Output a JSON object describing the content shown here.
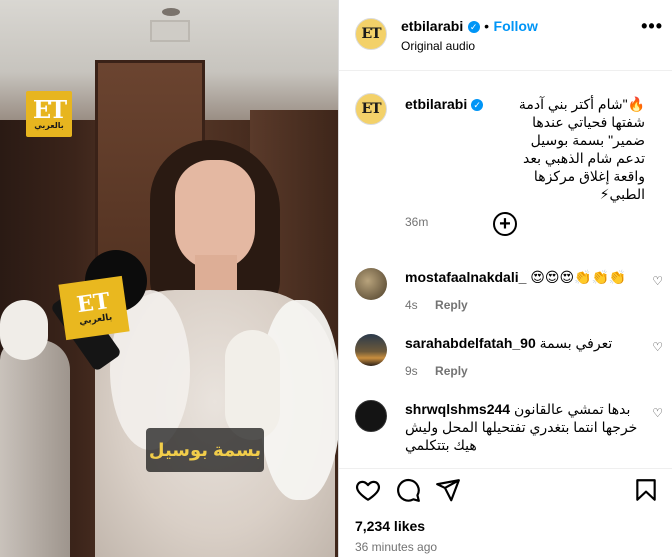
{
  "media": {
    "logo": {
      "big": "ET",
      "small": "بالعربي"
    },
    "mic_logo": {
      "big": "ET",
      "small": "بالعربي"
    },
    "caption_overlay": "بسمة بوسيل"
  },
  "header": {
    "username": "etbilarabi",
    "verified_icon": "verified-badge-icon",
    "dot": "•",
    "follow_label": "Follow",
    "subtitle": "Original audio",
    "avatar_text": "ET",
    "more_icon": "more-horizontal-icon"
  },
  "caption": {
    "username": "etbilarabi",
    "avatar_text": "ET",
    "text": "🔥\"شام أكتر بني آدمة شفتها فحياتي عندها ضمير\" بسمة بوسيل تدعم شام الذهبي بعد واقعة إغلاق مركزها الطبي⚡",
    "time": "36m"
  },
  "load_more_icon": "plus-circle-icon",
  "comments": [
    {
      "username": "mostafaalnakdali_",
      "text": "😍😍😍👏👏👏",
      "time": "4s",
      "reply_label": "Reply"
    },
    {
      "username": "sarahabdelfatah_90",
      "text": "تعرفي بسمة",
      "time": "9s",
      "reply_label": "Reply"
    },
    {
      "username": "shrwqlshms244",
      "text": "بدها تمشي عالقانون خرجها انتما بتغدري تفتحيلها المحل وليش هيك بتتكلمي",
      "time": "",
      "reply_label": ""
    }
  ],
  "actions": {
    "like_icon": "heart-icon",
    "comment_icon": "comment-icon",
    "share_icon": "share-icon",
    "save_icon": "bookmark-icon"
  },
  "likes": "7,234 likes",
  "posted": "36 minutes ago",
  "colors": {
    "accent": "#0095f6",
    "brand": "#e7b51f",
    "muted": "#737373"
  }
}
